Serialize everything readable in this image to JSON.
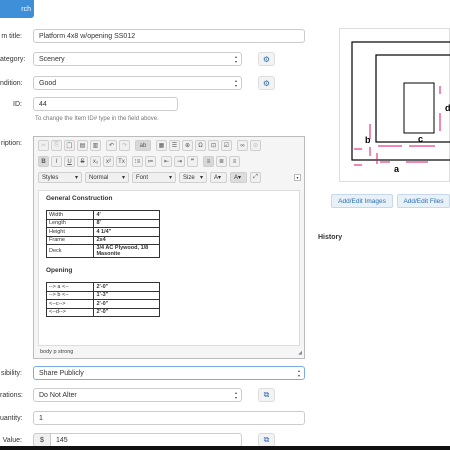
{
  "top_button": {
    "label": "rch"
  },
  "form": {
    "title": {
      "label": "m title:",
      "value": "Platform 4x8 w/opening SS012"
    },
    "category": {
      "label": "ategory:",
      "value": "Scenery"
    },
    "condition": {
      "label": "ndition:",
      "value": "Good"
    },
    "id": {
      "label": "ID:",
      "value": "44",
      "hint": "To change the Item ID# type in the field above."
    },
    "description": {
      "label": "ription:"
    },
    "visibility": {
      "label": "sibility:",
      "value": "Share Publicly"
    },
    "alterations": {
      "label": "rations:",
      "value": "Do Not Alter"
    },
    "quantity": {
      "label": "uantity:",
      "value": "1"
    },
    "value": {
      "label": "Value:",
      "currency": "$",
      "amount": "145"
    }
  },
  "editor": {
    "toolbar_row1": [
      "✂",
      "⎘",
      "📋",
      "▤",
      "▥",
      "↶",
      "↷",
      "ab",
      "▦",
      "☰",
      "⊕",
      "Ω",
      "⊡",
      "☑",
      "∞",
      "⊘"
    ],
    "toolbar_row2": [
      "B",
      "I",
      "U",
      "S",
      "x₂",
      "x²",
      "Tx",
      "⁝≡",
      "≔",
      "⇤",
      "⇥",
      "❞",
      "≡",
      "≣",
      "≡"
    ],
    "styles": "Styles",
    "format": "Normal",
    "font": "Font",
    "size": "Size",
    "heading1": "General Construction",
    "spec_rows": [
      [
        "Width",
        "4'"
      ],
      [
        "Length",
        "8'"
      ],
      [
        "Height",
        "4 1/4\""
      ],
      [
        "Frame",
        "2x4"
      ],
      [
        "Deck",
        "3/4 AC Plywood, 1/8 Masonite"
      ]
    ],
    "heading2": "Opening",
    "opening_rows": [
      [
        "--> a <--",
        "2'-0\""
      ],
      [
        "--> b <--",
        "1'-3\""
      ],
      [
        "<--c-->",
        "2'-0\""
      ],
      [
        "<--d-->",
        "2'-0\""
      ]
    ],
    "statusbar": "body  p  strong"
  },
  "diagram": {
    "labels": [
      "a",
      "b",
      "c",
      "d"
    ]
  },
  "buttons": {
    "edit_images": "Add/Edit Images",
    "edit_files": "Add/Edit Files"
  },
  "history": {
    "label": "History"
  }
}
